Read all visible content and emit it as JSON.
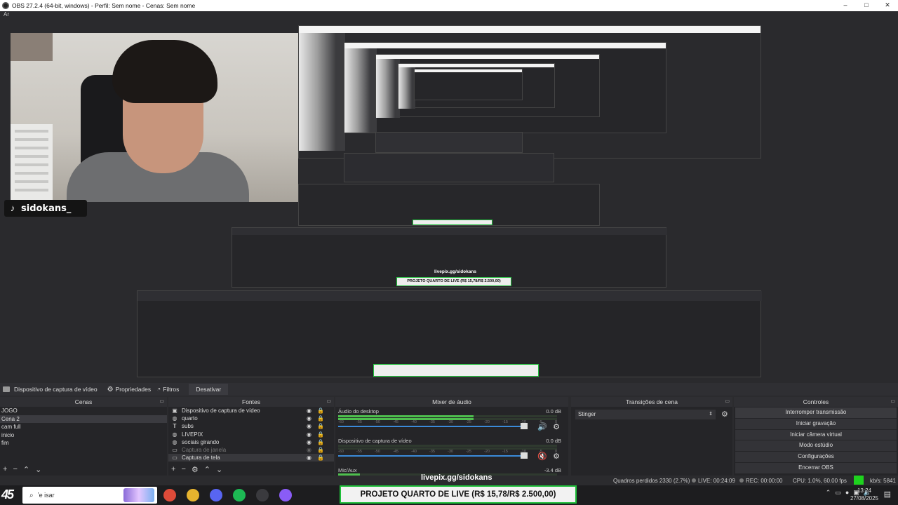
{
  "window": {
    "title": "OBS 27.2.4 (64-bit, windows) - Perfil: Sem nome - Cenas: Sem nome",
    "minimize": "–",
    "maximize": "□",
    "close": "✕"
  },
  "menubar": {
    "first": "Ar"
  },
  "preview": {
    "overlay_name": "sidokans_",
    "nested_livepix": "livepix.gg/sidokans",
    "nested_banner": "PROJETO QUARTO DE LIVE (R$ 15,78/R$ 2.500,00)"
  },
  "dockbar": {
    "source": "Dispositivo de captura de vídeo",
    "properties": "Propriedades",
    "filters": "Filtros",
    "deactivate": "Desativar"
  },
  "scenes": {
    "header": "Cenas",
    "items": [
      {
        "label": "JOGO"
      },
      {
        "label": "Cena 2"
      },
      {
        "label": "cam full"
      },
      {
        "label": "inicio"
      },
      {
        "label": "fim"
      }
    ]
  },
  "sources": {
    "header": "Fontes",
    "items": [
      {
        "label": "Dispositivo de captura de vídeo",
        "icon": "camera-icon"
      },
      {
        "label": "quarto",
        "icon": "globe-icon"
      },
      {
        "label": "subs",
        "icon": "text-icon"
      },
      {
        "label": "LIVEPIX",
        "icon": "globe-icon"
      },
      {
        "label": "sociais girando",
        "icon": "globe-icon"
      },
      {
        "label": "Captura de janela",
        "icon": "window-icon"
      },
      {
        "label": "Captura de tela",
        "icon": "monitor-icon"
      }
    ]
  },
  "mixer": {
    "header": "Mixer de áudio",
    "tracks": [
      {
        "name": "Áudio do desktop",
        "db": "0.0 dB",
        "level": 0.62,
        "muted": false
      },
      {
        "name": "Dispositivo de captura de vídeo",
        "db": "0.0 dB",
        "level": 0.0,
        "muted": true
      },
      {
        "name": "Mic/Aux",
        "db": "-3.4 dB",
        "level": 0.1,
        "muted": false
      }
    ],
    "ticks": [
      "-60",
      "-55",
      "-50",
      "-45",
      "-40",
      "-35",
      "-30",
      "-25",
      "-20",
      "-15",
      "-10",
      "-5",
      "0"
    ]
  },
  "transitions": {
    "header": "Transições de cena",
    "selected": "Stinger"
  },
  "controls": {
    "header": "Controles",
    "buttons": [
      {
        "label": "Interromper transmissão"
      },
      {
        "label": "Iniciar gravação"
      },
      {
        "label": "Iniciar câmera virtual"
      },
      {
        "label": "Modo estúdio"
      },
      {
        "label": "Configurações"
      },
      {
        "label": "Encerrar OBS"
      }
    ]
  },
  "status": {
    "dropped": "Quadros perdidos 2330 (2.7%)",
    "live": "LIVE: 00:24:09",
    "rec": "REC: 00:00:00",
    "cpu": "CPU: 1.0%, 60.00 fps",
    "kbps": "kb/s: 5841"
  },
  "overlay": {
    "livepix": "livepix.gg/sidokans",
    "banner": "PROJETO QUARTO DE LIVE (R$ 15,78/R$ 2.500,00)"
  },
  "taskbar": {
    "logo": "45",
    "search_text": "ʽе іsar",
    "time": "13:24",
    "date": "27/08/2025",
    "apps": [
      {
        "name": "chrome-icon",
        "color": "#dd4b39"
      },
      {
        "name": "folder-icon",
        "color": "#e6b32e"
      },
      {
        "name": "discord-icon",
        "color": "#5865f2"
      },
      {
        "name": "spotify-icon",
        "color": "#1db954"
      },
      {
        "name": "obs-icon",
        "color": "#3a3a3e"
      },
      {
        "name": "twitch-icon",
        "color": "#8a5cf6"
      }
    ]
  }
}
